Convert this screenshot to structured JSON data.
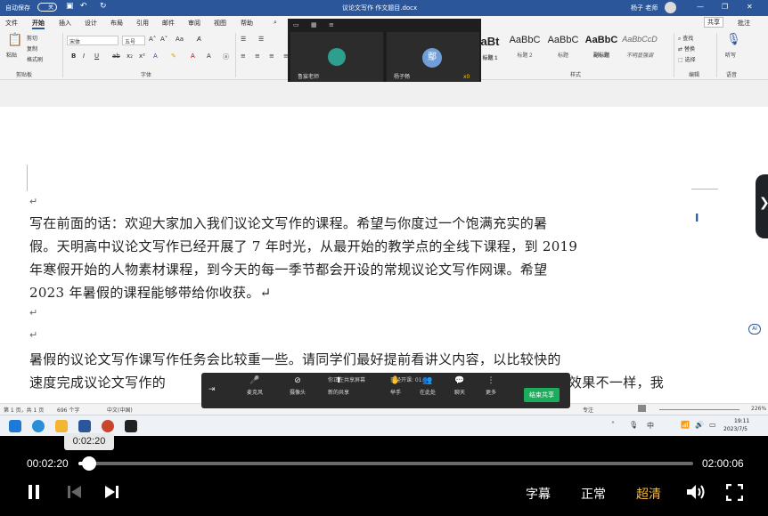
{
  "window": {
    "autosave_label": "自动保存",
    "autosave_state": "关",
    "doc_title": "议论文写作  作文题目.docx",
    "user_name": "杨子 老师",
    "share_button": "共享",
    "comments_button": "批注"
  },
  "menu": [
    "文件",
    "开始",
    "插入",
    "设计",
    "布局",
    "引用",
    "邮件",
    "审阅",
    "视图",
    "帮助"
  ],
  "ribbon": {
    "paste": "粘贴",
    "cut": "剪切",
    "copy": "复制",
    "format_painter": "格式刷",
    "clipboard_group": "剪贴板",
    "font_name": "宋体",
    "font_size": "五号",
    "font_group": "字体",
    "styles_group": "样式",
    "editing_group": "编辑",
    "voice_group": "语音",
    "find": "查找",
    "replace": "替换",
    "select": "选择",
    "dictate": "听写",
    "styles": [
      {
        "preview": "aBt",
        "name": "标题 1"
      },
      {
        "preview": "AaBbC",
        "name": "标题 2"
      },
      {
        "preview": "AaBbC",
        "name": "标题"
      },
      {
        "preview": "AaBbC",
        "name": "副标题"
      },
      {
        "preview": "AaBbCcD",
        "name": "不明显强调"
      }
    ]
  },
  "meeting": {
    "participants": [
      {
        "name": "鲁宸老师"
      },
      {
        "name": "杨子畅",
        "initials": "鄢"
      }
    ],
    "reaction_count": "x0"
  },
  "document": {
    "lines": [
      "写在前面的话：欢迎大家加入我们议论文写作的课程。希望与你度过一个饱满充实的暑",
      "假。天明高中议论文写作已经开展了 7 年时光，从最开始的教学点的全线下课程，到 2019",
      "年寒假开始的人物素材课程，到今天的每一季节都会开设的常规议论文写作网课。希望",
      "2023 年暑假的课程能够带给你收获。↵",
      "暑假的议论文写作课写作任务会比较重一些。请同学们最好提前看讲义内容，以比较快的",
      "速度完成议论文写作的",
      "效果不一样，我"
    ],
    "para_mark": "↵"
  },
  "share_bar": {
    "sharing_notice": "你正在共享屏幕",
    "recording": "已经开课: 01:46",
    "items": [
      "麦克风",
      "摄像头",
      "新的共享",
      "举手",
      "在此处",
      "聊天",
      "更多"
    ],
    "end_share": "结束共享"
  },
  "statusbar": {
    "page": "第 1 页，共 1 页",
    "words": "696 个字",
    "lang": "中文(中国)",
    "focus": "专注",
    "zoom": "226%"
  },
  "taskbar": {
    "time": "19:11",
    "date": "2023/7/5"
  },
  "player": {
    "tooltip": "0:02:20",
    "current": "00:02:20",
    "total": "02:00:06",
    "progress": 0.017,
    "subtitle": "字幕",
    "speed": "正常",
    "quality": "超清"
  },
  "colors": {
    "word_blue": "#2b579a",
    "end_share_green": "#1aad5b"
  }
}
